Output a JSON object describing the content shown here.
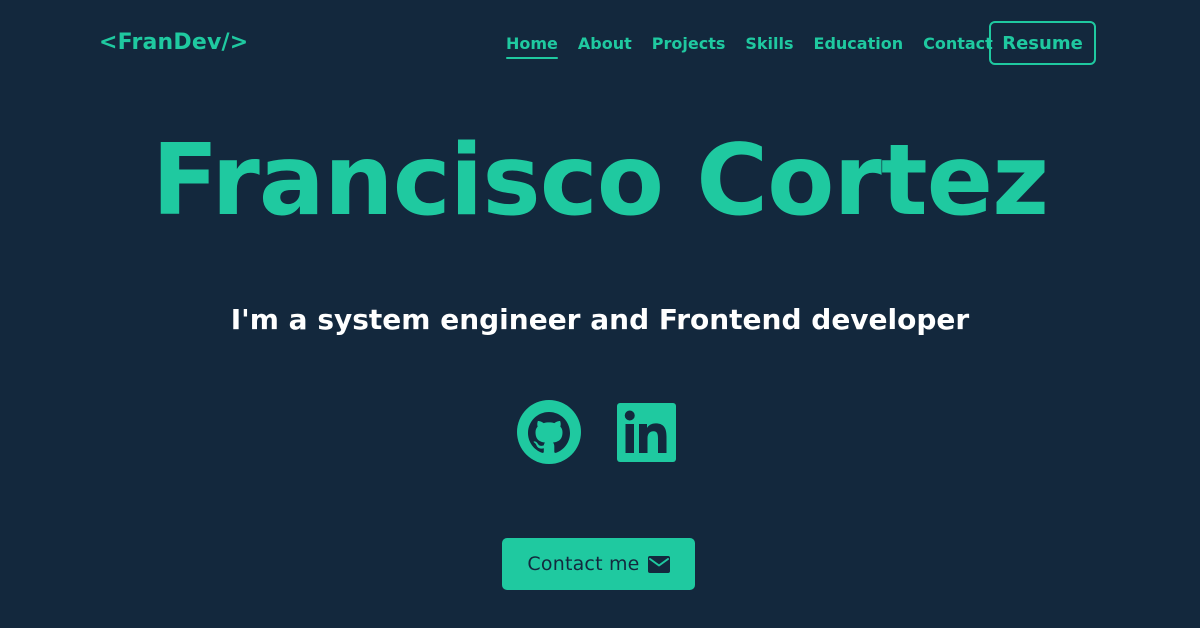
{
  "brand": {
    "logo_text": "<FranDev/>"
  },
  "nav": {
    "items": [
      {
        "label": "Home",
        "active": true
      },
      {
        "label": "About",
        "active": false
      },
      {
        "label": "Projects",
        "active": false
      },
      {
        "label": "Skills",
        "active": false
      },
      {
        "label": "Education",
        "active": false
      },
      {
        "label": "Contact",
        "active": false
      }
    ],
    "resume_label": "Resume"
  },
  "hero": {
    "name": "Francisco Cortez",
    "tagline": "I'm a system engineer and Frontend developer"
  },
  "social": {
    "icons": [
      "github-icon",
      "linkedin-icon"
    ]
  },
  "cta": {
    "contact_label": "Contact me",
    "icon": "mail-icon"
  },
  "colors": {
    "background": "#13283d",
    "accent": "#1fc9a0",
    "text_light": "#ffffff"
  }
}
